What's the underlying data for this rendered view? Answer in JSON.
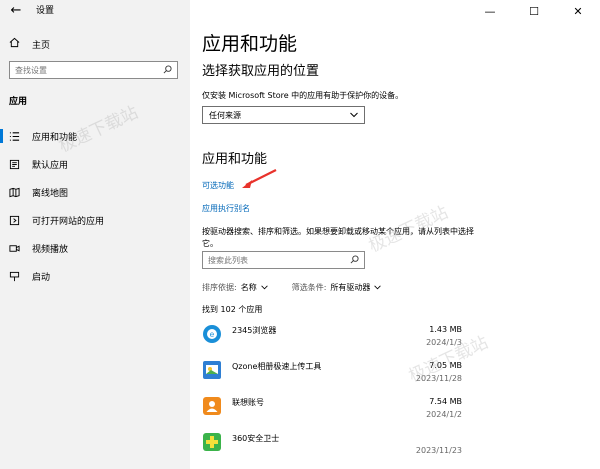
{
  "window": {
    "title": "设置",
    "controls": [
      "—",
      "☐",
      "✕"
    ]
  },
  "sidebar": {
    "home_label": "主页",
    "search_placeholder": "查找设置",
    "section_label": "应用",
    "items": [
      {
        "label": "应用和功能",
        "icon": "list-icon",
        "active": true
      },
      {
        "label": "默认应用",
        "icon": "default-apps-icon",
        "active": false
      },
      {
        "label": "离线地图",
        "icon": "map-icon",
        "active": false
      },
      {
        "label": "可打开网站的应用",
        "icon": "website-apps-icon",
        "active": false
      },
      {
        "label": "视频播放",
        "icon": "video-icon",
        "active": false
      },
      {
        "label": "启动",
        "icon": "startup-icon",
        "active": false
      }
    ]
  },
  "main": {
    "page_title": "应用和功能",
    "choose_title": "选择获取应用的位置",
    "choose_desc": "仅安装 Microsoft Store 中的应用有助于保护你的设备。",
    "source_value": "任何来源",
    "section_title": "应用和功能",
    "optional_features_link": "可选功能",
    "alias_link": "应用执行别名",
    "help_text": "按驱动器搜索、排序和筛选。如果想要卸载或移动某个应用，请从列表中选择它。",
    "filter_placeholder": "搜索此列表",
    "sort_label": "排序依据:",
    "sort_value": "名称",
    "filter_label": "筛选条件:",
    "filter_value": "所有驱动器",
    "found_text": "找到 102 个应用",
    "apps": [
      {
        "name": "2345浏览器",
        "size": "1.43 MB",
        "date": "2024/1/3",
        "color": "#1a8fd8"
      },
      {
        "name": "Qzone相册极速上传工具",
        "size": "7.05 MB",
        "date": "2023/11/28",
        "color": "#2f7fd3"
      },
      {
        "name": "联想账号",
        "size": "7.54 MB",
        "date": "2024/1/2",
        "color": "#f08a1c"
      },
      {
        "name": "360安全卫士",
        "size": "",
        "date": "2023/11/23",
        "color": "#3bb34a"
      }
    ]
  },
  "watermark_text": "极速下载站",
  "colors": {
    "accent": "#0078d7",
    "link": "#0067b8",
    "sidebar_bg": "#f2f2f2",
    "annotation": "#e8322b"
  }
}
